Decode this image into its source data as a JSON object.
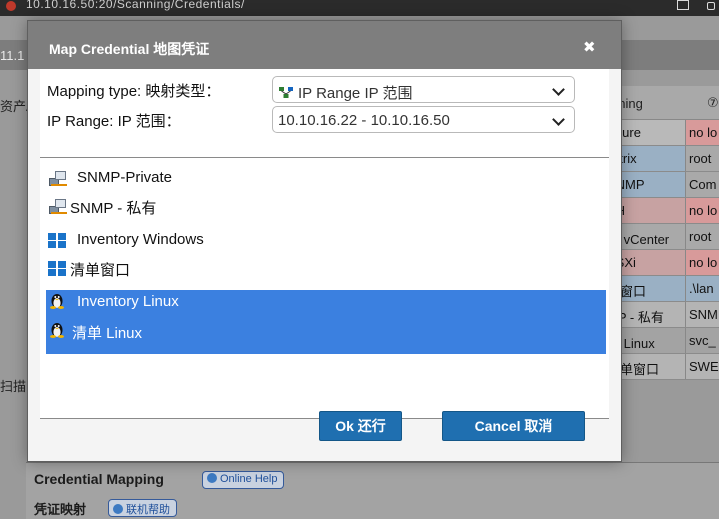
{
  "browser": {
    "url": "10.10.16.50:20/Scanning/Credentials/"
  },
  "background": {
    "ip_fragment": "11.1",
    "left_label_1": "资产As",
    "left_label_2": "扫描",
    "grid_header": {
      "col1": "nning",
      "col2": "⑦"
    },
    "grid_rows": [
      {
        "c1": "Azure",
        "c2": "no lo",
        "c1_bg": "#b9b9b9",
        "c2_bg": "#d89a9a"
      },
      {
        "c1": "Citrix",
        "c2": "root",
        "c1_bg": "#9ab0c4",
        "c2_bg": "#a9a9a9"
      },
      {
        "c1": "SNMP",
        "c2": "Com",
        "c1_bg": "#9ab0c4",
        "c2_bg": "#a9a9a9"
      },
      {
        "c1": "SH",
        "c2": "no lo",
        "c1_bg": "#c7a2a2",
        "c2_bg": "#d89a9a"
      },
      {
        "c1": "球 vCenter",
        "c2": "root",
        "c1_bg": "#a9a9a9",
        "c2_bg": "#a9a9a9"
      },
      {
        "c1": "ESXi",
        "c2": "no lo",
        "c1_bg": "#c7a2a2",
        "c2_bg": "#d89a9a"
      },
      {
        "c1": "局窗口",
        "c2": ".\\lan",
        "c1_bg": "#9ab0c4",
        "c2_bg": "#9ab0c4"
      },
      {
        "c1": "MP - 私有",
        "c2": "SNM",
        "c1_bg": "#b4b4b4",
        "c2_bg": "#b4b4b4"
      },
      {
        "c1": "单 Linux",
        "c2": "svc_",
        "c1_bg": "#a3a3a3",
        "c2_bg": "#a3a3a3"
      },
      {
        "c1": "清单窗口",
        "c2": "SWE",
        "c1_bg": "#b4b4b4",
        "c2_bg": "#b4b4b4"
      }
    ],
    "bottom": {
      "credential_mapping": "Credential Mapping",
      "online_help": "Online Help",
      "credential_mapping_cn": "凭证映射",
      "online_help_cn": "联机帮助"
    }
  },
  "modal": {
    "title": "Map Credential  地图凭证",
    "close_glyph": "✖",
    "mapping_type_label": "Mapping type:  映射类型：",
    "mapping_type_value": "IP Range  IP 范围",
    "ip_range_label": "IP Range:  IP 范围：",
    "ip_range_value": "10.10.16.22 - 10.10.16.50",
    "items": [
      {
        "label": "SNMP-Private",
        "icon": "snmp-icon",
        "selected": false
      },
      {
        "label": "SNMP - 私有",
        "icon": "snmp-icon",
        "selected": false
      },
      {
        "label": "Inventory Windows",
        "icon": "windows-icon",
        "selected": false
      },
      {
        "label": "清单窗口",
        "icon": "windows-icon",
        "selected": false
      },
      {
        "label": "Inventory Linux",
        "icon": "linux-icon",
        "selected": true
      },
      {
        "label": "清单 Linux",
        "icon": "linux-icon",
        "selected": true
      }
    ],
    "ok_label": "Ok  还行",
    "cancel_label": "Cancel  取消"
  },
  "colors": {
    "accent_button": "#1f6fb0",
    "selection": "#3b80e0",
    "title_bar": "#7e7e7e"
  }
}
